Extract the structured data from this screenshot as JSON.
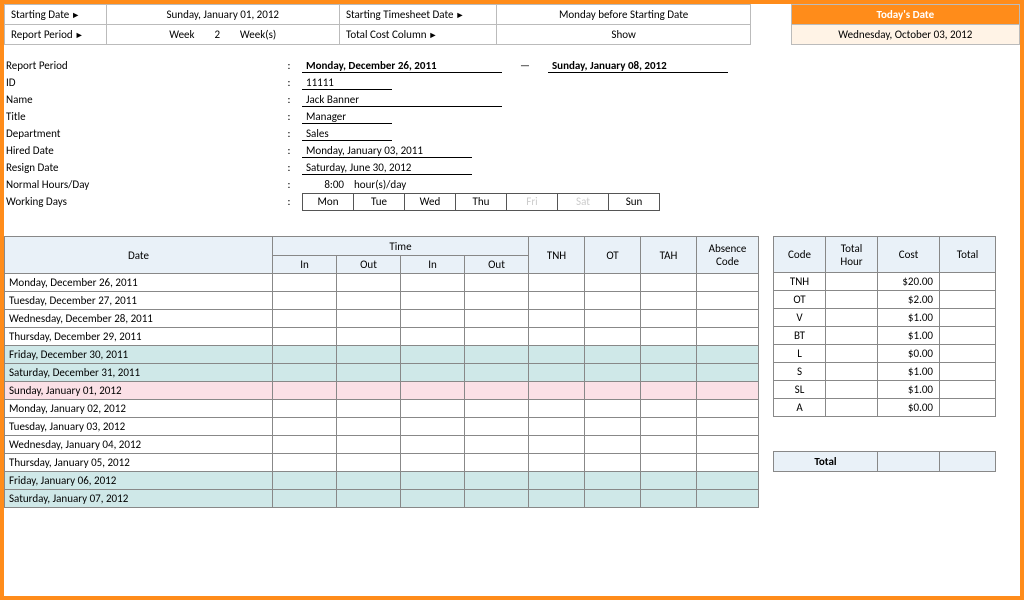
{
  "header": {
    "starting_date_lbl": "Starting Date",
    "starting_date": "Sunday, January 01, 2012",
    "starting_ts_lbl": "Starting Timesheet Date",
    "starting_ts": "Monday before Starting Date",
    "report_period_lbl": "Report Period",
    "week_lbl": "Week",
    "week_num": "2",
    "weeks_lbl": "Week(s)",
    "total_cost_lbl": "Total Cost Column",
    "total_cost_val": "Show",
    "today_lbl": "Today's Date",
    "today_val": "Wednesday, October 03, 2012"
  },
  "info": {
    "report_period_lbl": "Report Period",
    "report_period_from": "Monday, December 26, 2011",
    "report_period_to": "Sunday, January 08, 2012",
    "id_lbl": "ID",
    "id": "11111",
    "name_lbl": "Name",
    "name": "Jack Banner",
    "title_lbl": "Title",
    "title": "Manager",
    "dept_lbl": "Department",
    "dept": "Sales",
    "hired_lbl": "Hired Date",
    "hired": "Monday, January 03, 2011",
    "resign_lbl": "Resign Date",
    "resign": "Saturday, June 30, 2012",
    "hours_lbl": "Normal Hours/Day",
    "hours_val": "8:00",
    "hours_unit": "hour(s)/day",
    "workdays_lbl": "Working Days",
    "days": [
      "Mon",
      "Tue",
      "Wed",
      "Thu",
      "Fri",
      "Sat",
      "Sun"
    ],
    "days_off": [
      4,
      5
    ]
  },
  "timesheet": {
    "cols": {
      "date": "Date",
      "time": "Time",
      "in": "In",
      "out": "Out",
      "tnh": "TNH",
      "ot": "OT",
      "tah": "TAH",
      "abs": "Absence Code"
    },
    "rows": [
      {
        "d": "Monday, December 26, 2011",
        "hl": ""
      },
      {
        "d": "Tuesday, December 27, 2011",
        "hl": ""
      },
      {
        "d": "Wednesday, December 28, 2011",
        "hl": ""
      },
      {
        "d": "Thursday, December 29, 2011",
        "hl": ""
      },
      {
        "d": "Friday, December 30, 2011",
        "hl": "teal"
      },
      {
        "d": "Saturday, December 31, 2011",
        "hl": "teal"
      },
      {
        "d": "Sunday, January 01, 2012",
        "hl": "pink"
      },
      {
        "d": "Monday, January 02, 2012",
        "hl": ""
      },
      {
        "d": "Tuesday, January 03, 2012",
        "hl": ""
      },
      {
        "d": "Wednesday, January 04, 2012",
        "hl": ""
      },
      {
        "d": "Thursday, January 05, 2012",
        "hl": ""
      },
      {
        "d": "Friday, January 06, 2012",
        "hl": "teal"
      },
      {
        "d": "Saturday, January 07, 2012",
        "hl": "teal"
      }
    ]
  },
  "cost": {
    "cols": {
      "code": "Code",
      "th": "Total Hour",
      "cost": "Cost",
      "total": "Total"
    },
    "rows": [
      {
        "code": "TNH",
        "cost": "$20.00"
      },
      {
        "code": "OT",
        "cost": "$2.00"
      },
      {
        "code": "V",
        "cost": "$1.00"
      },
      {
        "code": "BT",
        "cost": "$1.00"
      },
      {
        "code": "L",
        "cost": "$0.00"
      },
      {
        "code": "S",
        "cost": "$1.00"
      },
      {
        "code": "SL",
        "cost": "$1.00"
      },
      {
        "code": "A",
        "cost": "$0.00"
      }
    ],
    "total_lbl": "Total"
  }
}
